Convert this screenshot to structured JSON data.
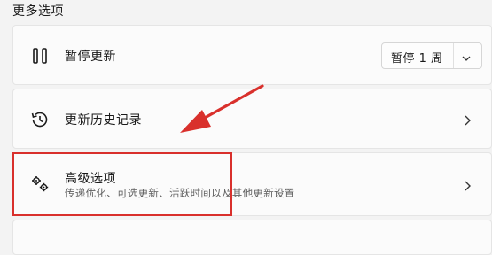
{
  "section": {
    "title": "更多选项"
  },
  "pause_updates": {
    "icon": "pause-icon",
    "label": "暂停更新",
    "select_value": "暂停 1 周"
  },
  "update_history": {
    "icon": "history-icon",
    "label": "更新历史记录"
  },
  "advanced_options": {
    "icon": "gears-icon",
    "label": "高级选项",
    "description": "传递优化、可选更新、活跃时间以及其他更新设置"
  },
  "annotation": {
    "color": "#d9302c"
  }
}
